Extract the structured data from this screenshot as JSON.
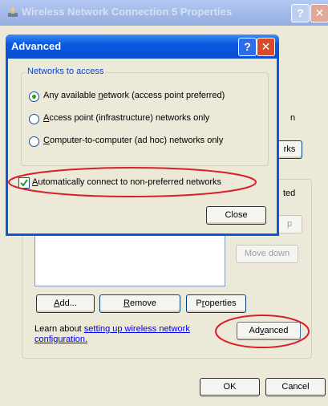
{
  "background_window": {
    "title": "Wireless Network Connection 5 Properties",
    "help_glyph": "?",
    "close_glyph": "✕",
    "partial_text_n": "n",
    "partial_btn_rks": "rks",
    "partial_text_ted": "ted",
    "partial_btn_p": "p",
    "move_down": "Move down",
    "add": "Add...",
    "remove": "Remove",
    "properties": "Properties",
    "learn_about": "Learn about ",
    "learn_link": "setting up wireless network configuration.",
    "advanced": "Advanced",
    "ok": "OK",
    "cancel": "Cancel"
  },
  "advanced_dialog": {
    "title": "Advanced",
    "help_glyph": "?",
    "close_glyph": "✕",
    "group_label": "Networks to access",
    "options": [
      {
        "label": "Any available network (access point preferred)",
        "selected": true
      },
      {
        "label": "Access point (infrastructure) networks only",
        "selected": false
      },
      {
        "label": "Computer-to-computer (ad hoc) networks only",
        "selected": false
      }
    ],
    "auto_connect": {
      "label": "Automatically connect to non-preferred networks",
      "checked": true
    },
    "close_button": "Close"
  },
  "colors": {
    "title_bar_inactive": "#9cb5e9",
    "title_bar_active": "#0a58e0",
    "close_red": "#d84a28",
    "highlight_red": "#d8202a",
    "dialog_face": "#ece9d8",
    "group_label_blue": "#0046d5"
  }
}
